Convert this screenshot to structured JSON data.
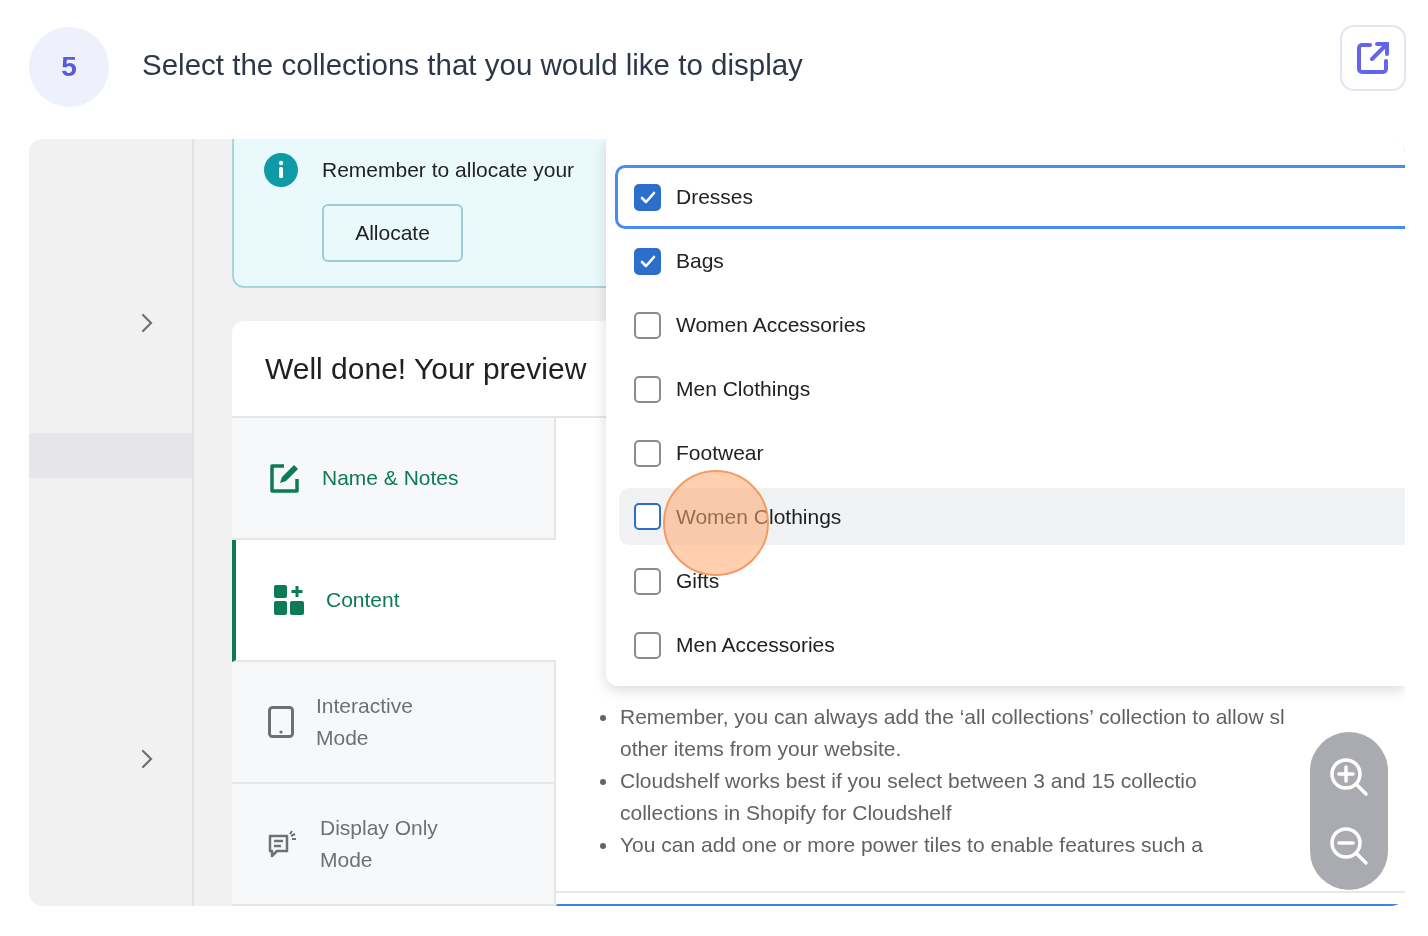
{
  "step": {
    "number": "5",
    "title": "Select the collections that you would like to display"
  },
  "sidebar": {
    "items": [
      {
        "kind": "chevron"
      },
      {
        "kind": "highlight"
      },
      {
        "kind": "chevron"
      }
    ]
  },
  "banner": {
    "text": "Remember to allocate your",
    "button": "Allocate"
  },
  "card": {
    "title": "Well done! Your preview",
    "tabs": [
      {
        "label": "Name & Notes",
        "selected": false,
        "completed": true
      },
      {
        "label": "Content",
        "selected": true,
        "completed": true
      },
      {
        "label": "Interactive Mode",
        "selected": false,
        "completed": false
      },
      {
        "label": "Display Only Mode",
        "selected": false,
        "completed": false
      }
    ],
    "bullets": [
      {
        "lines": [
          "Remember, you can always add the ‘all collections’ collection to allow sl",
          "other items from your website."
        ]
      },
      {
        "lines": [
          "Cloudshelf works best if you select between 3 and 15 collectio",
          "collections in Shopify for Cloudshelf"
        ]
      },
      {
        "lines": [
          "You can add one or more power tiles to enable features such a"
        ]
      }
    ]
  },
  "dropdown": {
    "options": [
      {
        "label": "Dresses",
        "checked": true,
        "focused": true,
        "hovered": false
      },
      {
        "label": "Bags",
        "checked": true,
        "focused": false,
        "hovered": false
      },
      {
        "label": "Women Accessories",
        "checked": false,
        "focused": false,
        "hovered": false
      },
      {
        "label": "Men Clothings",
        "checked": false,
        "focused": false,
        "hovered": false
      },
      {
        "label": "Footwear",
        "checked": false,
        "focused": false,
        "hovered": false
      },
      {
        "label": "Women Clothings",
        "checked": false,
        "focused": false,
        "hovered": true,
        "clicked": true
      },
      {
        "label": "Gifts",
        "checked": false,
        "focused": false,
        "hovered": false
      },
      {
        "label": "Men Accessories",
        "checked": false,
        "focused": false,
        "hovered": false
      }
    ]
  }
}
